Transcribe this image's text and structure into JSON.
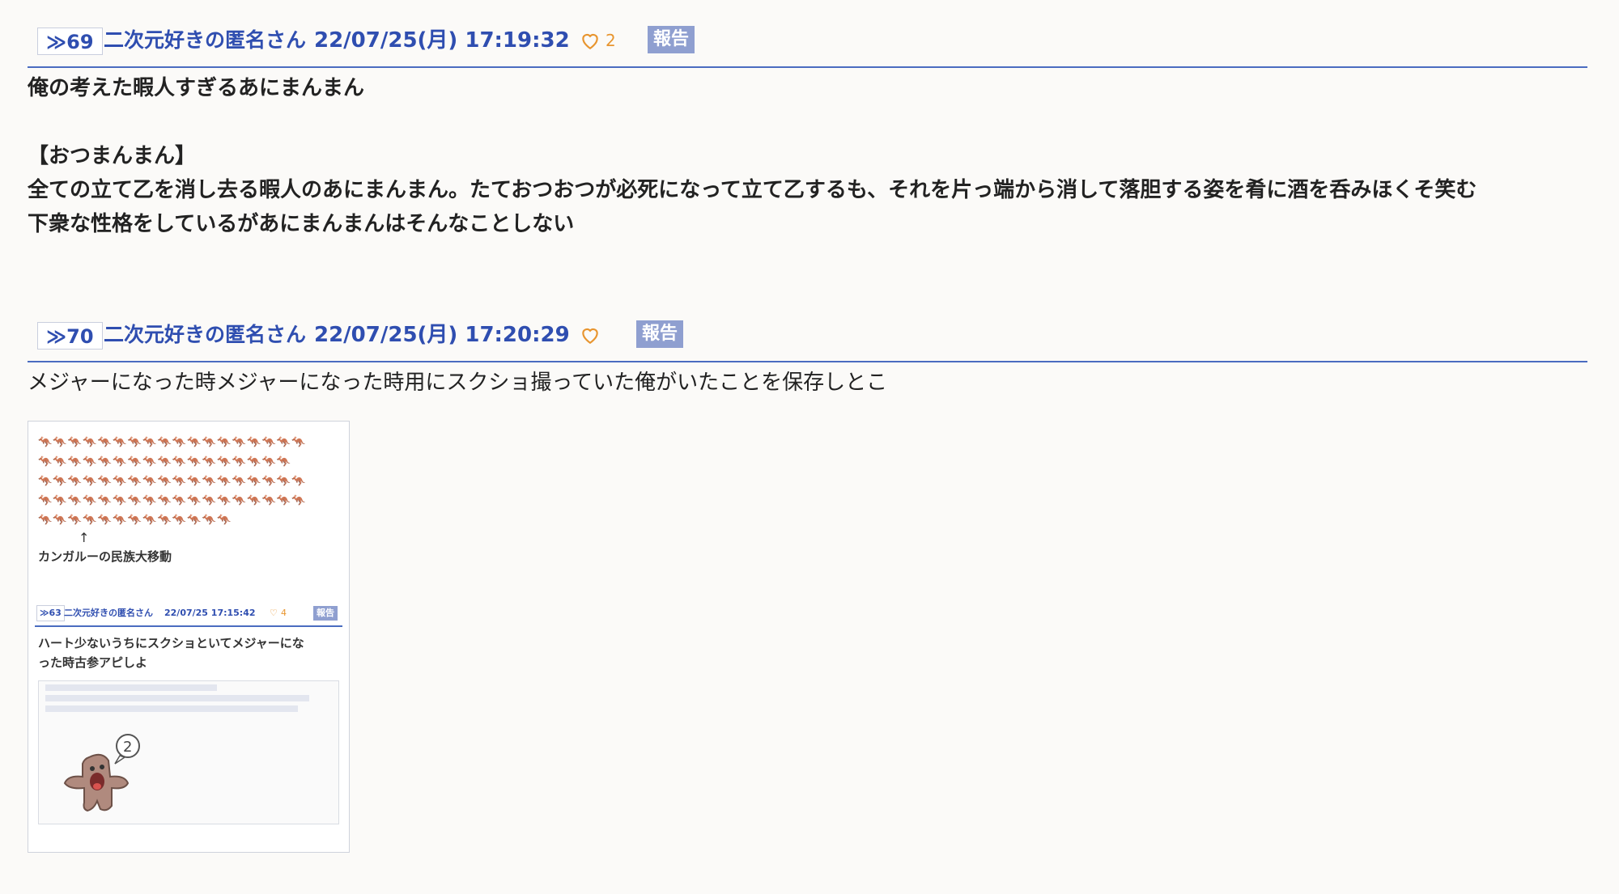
{
  "posts": [
    {
      "anchor": "≫69",
      "name": "二次元好きの匿名さん",
      "date": "22/07/25(月) 17:19:32",
      "like_count": "2",
      "report_label": "報告",
      "lines": [
        "俺の考えた暇人すぎるあにまんまん",
        "",
        "【おつまんまん】",
        "全ての立て乙を消し去る暇人のあにまんまん。たておつおつが必死になって立て乙するも、それを片っ端から消して落胆する姿を肴に酒を呑みほくそ笑む",
        "下衆な性格をしているがあにまんまんはそんなことしない"
      ]
    },
    {
      "anchor": "≫70",
      "name": "二次元好きの匿名さん",
      "date": "22/07/25(月) 17:20:29",
      "like_count": "",
      "report_label": "報告",
      "lines": [
        "メジャーになった時メジャーになった時用にスクショ撮っていた俺がいたことを保存しとこ"
      ],
      "image": {
        "arrow": "↑",
        "caption": "カンガルーの民族大移動",
        "kangaroo_rows": [
          "🦘🦘🦘🦘🦘🦘🦘🦘🦘🦘🦘🦘🦘🦘🦘🦘🦘🦘",
          "🦘🦘🦘🦘🦘🦘🦘🦘🦘🦘🦘🦘🦘🦘🦘🦘🦘",
          "🦘🦘🦘🦘🦘🦘🦘🦘🦘🦘🦘🦘🦘🦘🦘🦘🦘🦘",
          "🦘🦘🦘🦘🦘🦘🦘🦘🦘🦘🦘🦘🦘🦘🦘🦘🦘🦘",
          "🦘🦘🦘🦘🦘🦘🦘🦘🦘🦘🦘🦘🦘"
        ],
        "quoted_post": {
          "anchor": "≫63",
          "name": "二次元好きの匿名さん",
          "date": "22/07/25 17:15:42",
          "like_count": "4",
          "report_label": "報告",
          "body_lines": [
            "ハート少ないうちにスクショといてメジャーにな",
            "った時古参アピしよ"
          ]
        }
      }
    }
  ],
  "colors": {
    "link_blue": "#2f4eb0",
    "rule_blue": "#4a6cc0",
    "report_bg": "#8f9fd0",
    "heart": "#e8952f"
  },
  "icons": [
    "heart-icon",
    "heart-icon"
  ]
}
